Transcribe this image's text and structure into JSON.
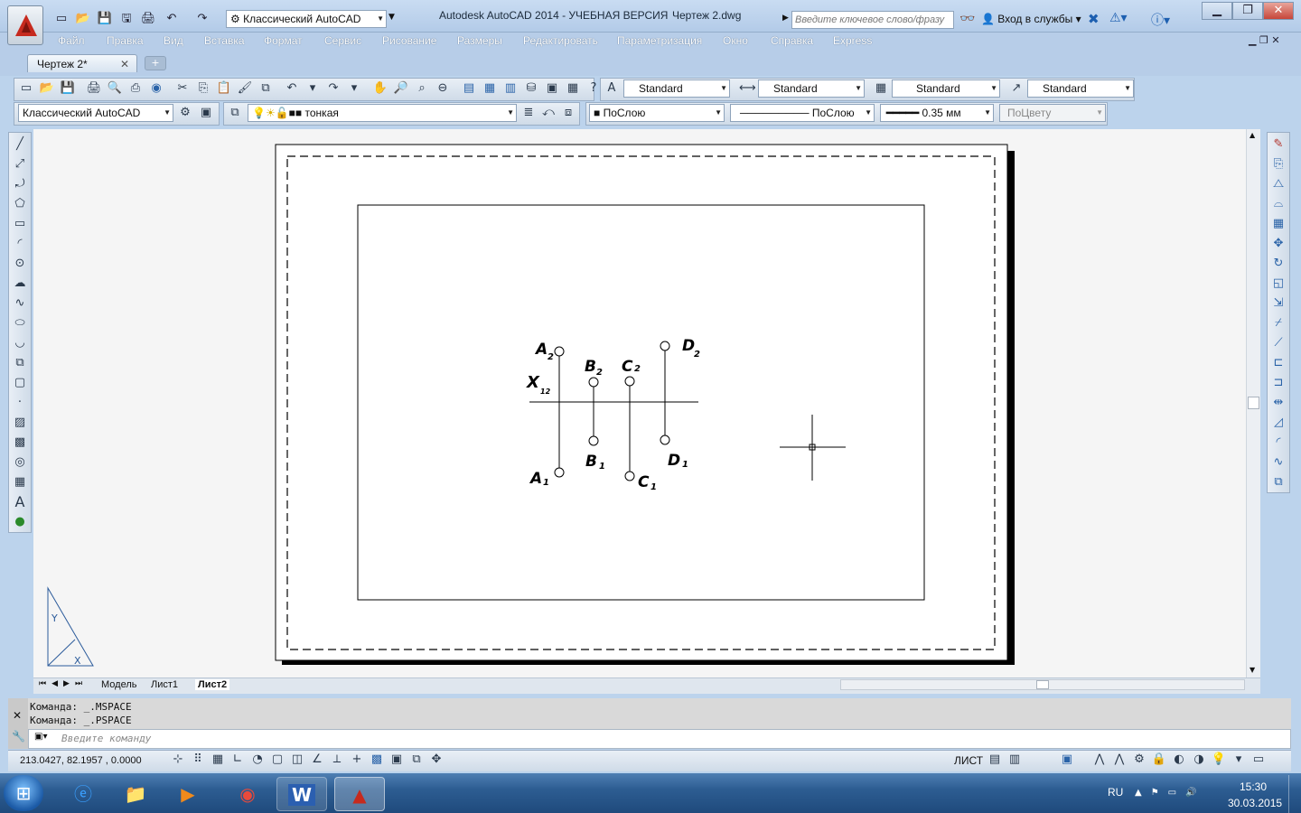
{
  "window": {
    "title": "Autodesk AutoCAD 2014 - УЧЕБНАЯ ВЕРСИЯ",
    "filename": "Чертеж 2.dwg",
    "workspace": "Классический AutoCAD",
    "search_placeholder": "Введите ключевое слово/фразу",
    "signin": "Вход в службы"
  },
  "menu": [
    "Файл",
    "Правка",
    "Вид",
    "Вставка",
    "Формат",
    "Сервис",
    "Рисование",
    "Размеры",
    "Редактировать",
    "Параметризация",
    "Окно",
    "Справка",
    "Express"
  ],
  "doc_tab": "Чертеж 2*",
  "styles": {
    "text_style": "Standard",
    "dim_style": "Standard",
    "table_style": "Standard",
    "multileader_style": "Standard"
  },
  "properties": {
    "workspace": "Классический AutoCAD",
    "layer": "тонкая",
    "color": "ПоСлою",
    "linetype": "ПоСлою",
    "lineweight": "0.35 мм",
    "plotstyle": "ПоЦвету"
  },
  "drawing": {
    "labels": {
      "a2": "A",
      "a2_sub": "2",
      "b2": "B",
      "b2_sub": "2",
      "c2": "C",
      "c2_sub": "2",
      "d2": "D",
      "d2_sub": "2",
      "x12": "X",
      "x12_sub": "12",
      "a1": "A",
      "a1_sub": "1",
      "b1": "B",
      "b1_sub": "1",
      "c1": "C",
      "c1_sub": "1",
      "d1": "D",
      "d1_sub": "1"
    }
  },
  "layout_tabs": [
    "Модель",
    "Лист1",
    "Лист2"
  ],
  "command": {
    "history": [
      "Команда:  _.MSPACE",
      "Команда:  _.PSPACE"
    ],
    "placeholder": "Введите команду"
  },
  "status": {
    "coords": "213.0427,  82.1957 , 0.0000",
    "space": "ЛИСТ"
  },
  "tray": {
    "lang": "RU",
    "time": "15:30",
    "date": "30.03.2015"
  }
}
